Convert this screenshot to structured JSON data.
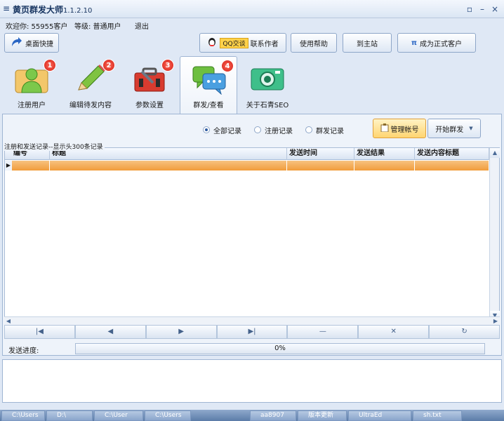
{
  "window": {
    "menu_glyph": "≡",
    "title": "黄页群发大师",
    "version": "1.1.2.10",
    "controls": [
      "▫",
      "–",
      "×"
    ]
  },
  "user": {
    "welcome": "欢迎你: 55955客户",
    "level": "等级: 普通用户",
    "logout": "退出"
  },
  "toolbar": {
    "desktop_shortcut": "桌面快捷",
    "qq_badge": "QQ交谈",
    "contact_author": "联系作者",
    "help": "使用帮助",
    "to_site": "到主站",
    "become_customer_icon": "π",
    "become_customer": "成为正式客户"
  },
  "tabs": [
    {
      "label": "注册用户",
      "num": "1",
      "icon": "user-icon"
    },
    {
      "label": "编辑待发内容",
      "num": "2",
      "icon": "pencil-icon"
    },
    {
      "label": "参数设置",
      "num": "3",
      "icon": "toolbox-icon"
    },
    {
      "label": "群发/查看",
      "num": "4",
      "icon": "chat-icon"
    },
    {
      "label": "关于石青SEO",
      "num": "",
      "icon": "camera-icon"
    }
  ],
  "filters": [
    {
      "label": "全部记录",
      "checked": true
    },
    {
      "label": "注册记录",
      "checked": false
    },
    {
      "label": "群发记录",
      "checked": false
    }
  ],
  "actions": {
    "manage_accounts": "管理帐号",
    "start_send": "开始群发"
  },
  "records": {
    "legend": "注册和发送记录--显示头300条记录",
    "columns": [
      "编号",
      "标题",
      "发送时间",
      "发送结果",
      "发送内容标题"
    ]
  },
  "nav": [
    "|◀",
    "◀",
    "▶",
    "▶|",
    "—",
    "✕",
    "↻"
  ],
  "progress": {
    "label": "发送进度:",
    "value": "0%"
  },
  "taskbar": [
    "C:\\Users",
    "D:\\",
    "C:\\User",
    "C:\\Users",
    "aa8907",
    "版本更新",
    "UltraEd",
    "sh.txt"
  ],
  "colors": {
    "accent": "#f19c3c",
    "panel": "#eef3fa",
    "badge": "#d11d14"
  }
}
